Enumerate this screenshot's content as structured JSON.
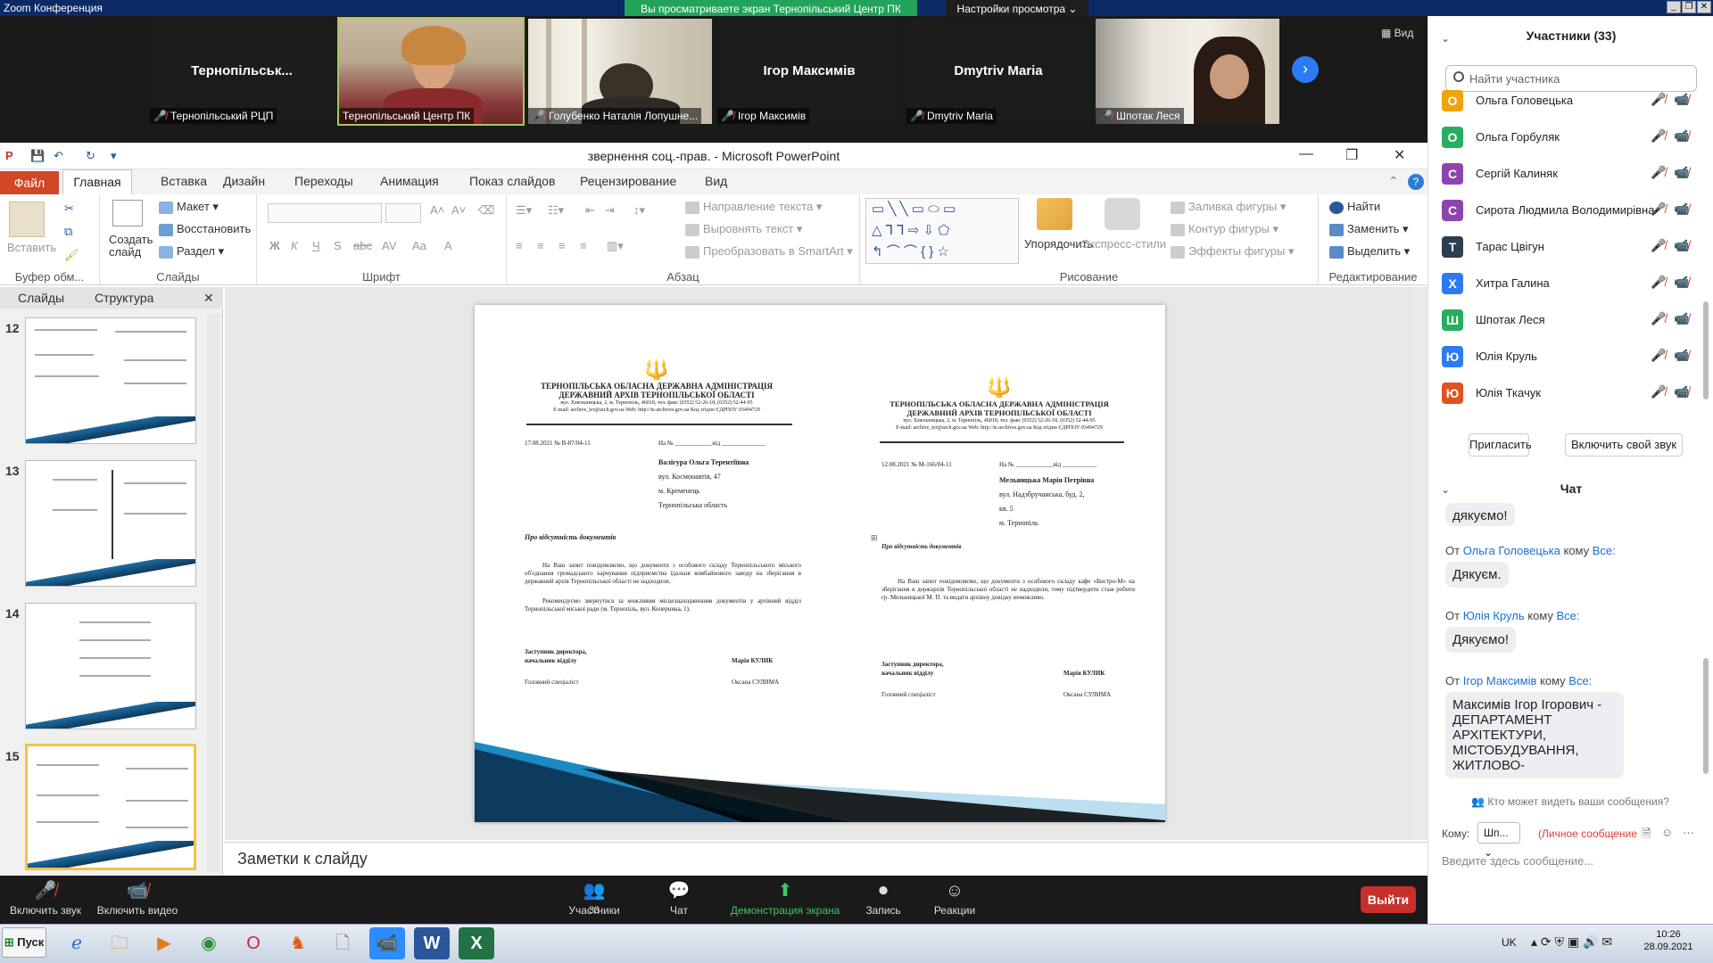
{
  "zoom": {
    "window_title": "Zoom Конференция",
    "share_banner": "Вы просматриваете экран Тернопільський Центр ПК",
    "view_options": "Настройки просмотра ⌄",
    "view_label": "Вид",
    "tiles": [
      {
        "big": "Тернопільськ...",
        "caption": "Тернопільський РЦП",
        "muted": true
      },
      {
        "big": "",
        "caption": "Тернопільський Центр ПК",
        "muted": false
      },
      {
        "big": "",
        "caption": "Голубенко Наталія Лопушне...",
        "muted": true
      },
      {
        "big": "Ігор Максимів",
        "caption": "Ігор Максимів",
        "muted": true
      },
      {
        "big": "Dmytriv Maria",
        "caption": "Dmytriv Maria",
        "muted": true
      },
      {
        "big": "",
        "caption": "Шпотак Леся",
        "muted": true
      }
    ],
    "controls": {
      "mute": "Включить звук",
      "video": "Включить видео",
      "participants": "Участники",
      "participants_count": "33",
      "chat": "Чат",
      "share": "Демонстрация экрана",
      "record": "Запись",
      "reactions": "Реакции",
      "leave": "Выйти"
    }
  },
  "ppt": {
    "title": "звернення соц.-прав.  -  Microsoft PowerPoint",
    "tabs": [
      "Файл",
      "Главная",
      "Вставка",
      "Дизайн",
      "Переходы",
      "Анимация",
      "Показ слайдов",
      "Рецензирование",
      "Вид"
    ],
    "ribbon": {
      "clipboard": {
        "paste": "Вставить",
        "group": "Буфер обм..."
      },
      "slides": {
        "new": "Создать слайд",
        "layout": "Макет",
        "reset": "Восстановить",
        "section": "Раздел",
        "group": "Слайды"
      },
      "font": {
        "group": "Шрифт"
      },
      "paragraph": {
        "direction": "Направление текста",
        "align": "Выровнять текст",
        "smartart": "Преобразовать в SmartArt",
        "group": "Абзац"
      },
      "drawing": {
        "arrange": "Упорядочить",
        "styles": "Экспресс-стили",
        "fill": "Заливка фигуры",
        "outline": "Контур фигуры",
        "effects": "Эффекты фигуры",
        "group": "Рисование"
      },
      "editing": {
        "find": "Найти",
        "replace": "Заменить",
        "select": "Выделить",
        "group": "Редактирование"
      }
    },
    "panel_tabs": [
      "Слайды",
      "Структура"
    ],
    "slide_numbers": [
      "12",
      "13",
      "14",
      "15"
    ],
    "notes_placeholder": "Заметки к слайду",
    "doc_left": {
      "org1": "ТЕРНОПІЛЬСЬКА ОБЛАСНА ДЕРЖАВНА АДМІНІСТРАЦІЯ",
      "org2": "ДЕРЖАВНИЙ АРХІВ ТЕРНОПІЛЬСЬКОЇ ОБЛАСТІ",
      "addr": "вул. Хмельницька, 2, м. Тернопіль, 46018, тел. факс (0352) 52-26-18, (0352) 52-44-95",
      "email": "E-mail: archive_ter@arch.gov.ua Web: http://te.archives.gov.ua Код згідно ЄДРПОУ 03494729",
      "date": "17.08.2021  № В-87/04-11",
      "ref": "На № ____________від ______________",
      "recipient": [
        "Валігура Ольга Терентіївна",
        "вул. Космонавтів, 47",
        "м. Кременець",
        "Тернопільська область"
      ],
      "subject": "Про відсутність документів",
      "body1": "На Ваш запит повідомляємо, що документи з особового складу Тернопільського міського об'єднання громадського харчування підприємства їдальня комбайнового заводу на зберігання в державний архів Тернопільської області не надходили.",
      "body2": "Рекомендуємо звернутися за можливим місцезнаходженням документів у архівний відділ Тернопільської міської ради (м. Тернопіль, вул. Коперника, 1).",
      "sig_title": "Заступник директора, начальник відділу",
      "sig_name": "Марія КУЛИК",
      "spec_title": "Головний спеціаліст",
      "spec_name": "Оксана СУЛИМА"
    },
    "doc_right": {
      "org1": "ТЕРНОПІЛЬСЬКА ОБЛАСНА ДЕРЖАВНА АДМІНІСТРАЦІЯ",
      "org2": "ДЕРЖАВНИЙ АРХІВ ТЕРНОПІЛЬСЬКОЇ ОБЛАСТІ",
      "addr": "вул. Хмельницька, 2, м. Тернопіль, 46018, тел. факс (0352) 52-26-18, (0352) 52-44-95",
      "email": "E-mail: archive_ter@arch.gov.ua Web: http://te.archives.gov.ua Код згідно ЄДРПОУ 03494729",
      "date": "12.08.2021  № М-166/04-11",
      "ref": "На № ____________від ___________",
      "recipient": [
        "Мельницька Марія Петрівна",
        "вул. Надзбручанська, буд. 2,",
        "кв. 5",
        "м. Тернопіль"
      ],
      "subject": "Про відсутність документів",
      "body1": "На Ваш запит повідомляємо, що документи з особового складу кафе «Бистро-М» на зберігання в держархів Тернопільської області не надходили, тому підтвердити стаж роботи гр. Мельницької М. П. та видати архівну довідку неможливо.",
      "sig_title": "Заступник директора, начальник відділу",
      "sig_name": "Марія КУЛИК",
      "spec_title": "Головний спеціаліст",
      "spec_name": "Оксана СУЛИМА"
    }
  },
  "panel": {
    "participants_title": "Участники (33)",
    "search_placeholder": "Найти участника",
    "participants": [
      {
        "initial": "О",
        "name": "Ольга Головецька",
        "color": "#f0a30a"
      },
      {
        "initial": "О",
        "name": "Ольга Горбуляк",
        "color": "#27ae60"
      },
      {
        "initial": "С",
        "name": "Сергій Калиняк",
        "color": "#8e44ad"
      },
      {
        "initial": "С",
        "name": "Сирота Людмила Володимирівна",
        "color": "#8e44ad"
      },
      {
        "initial": "Т",
        "name": "Тарас Цвігун",
        "color": "#2c3e50"
      },
      {
        "initial": "Х",
        "name": "Хитра Галина",
        "color": "#2d7bf4"
      },
      {
        "initial": "Ш",
        "name": "Шпотак Леся",
        "color": "#27ae60"
      },
      {
        "initial": "Ю",
        "name": "Юлія Круль",
        "color": "#2d7bf4"
      },
      {
        "initial": "Ю",
        "name": "Юлія Ткачук",
        "color": "#e0531f"
      }
    ],
    "invite": "Пригласить",
    "unmute_self": "Включить свой звук",
    "chat_title": "Чат",
    "chat": [
      {
        "from": "",
        "to": "",
        "text": "дякуємо!"
      },
      {
        "from": "Ольга Головецька",
        "to": "Все:",
        "text": "Дякуєм."
      },
      {
        "from": "Юлія Круль",
        "to": "Все:",
        "text": "Дякуємо!"
      },
      {
        "from": "Ігор Максимів",
        "to": "Все:",
        "text": "Максимів Ігор Ігорович - ДЕПАРТАМЕНТ АРХІТЕКТУРИ, МІСТОБУДУВАННЯ, ЖИТЛОВО-"
      }
    ],
    "from_label": "От",
    "to_label": "кому",
    "who_sees": "Кто может видеть ваши сообщения?",
    "to_prefix": "Кому:",
    "to_value": "Шп...",
    "private": "(Личное сообщение",
    "message_placeholder": "Введите здесь сообщение..."
  },
  "taskbar": {
    "start": "Пуск",
    "lang": "UK",
    "time": "10:26",
    "date": "28.09.2021"
  }
}
